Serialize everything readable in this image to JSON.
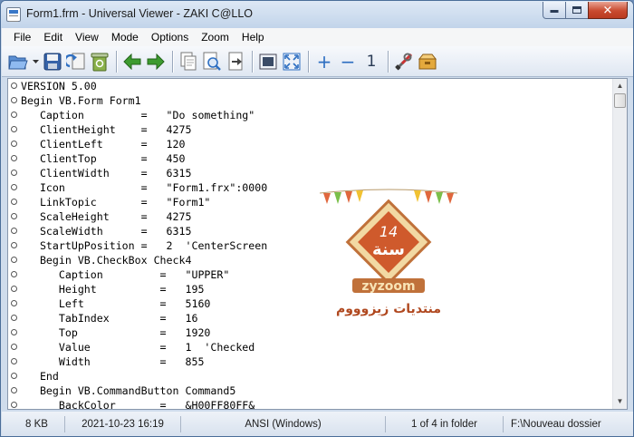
{
  "window": {
    "title": "Form1.frm - Universal Viewer - ZAKI C@LLO"
  },
  "window_controls": {
    "minimize": "",
    "maximize": "",
    "close": "✕"
  },
  "menu": {
    "items": [
      "File",
      "Edit",
      "View",
      "Mode",
      "Options",
      "Zoom",
      "Help"
    ]
  },
  "toolbar": {
    "buttons": [
      {
        "name": "open-icon"
      },
      {
        "name": "save-icon"
      },
      {
        "name": "reload-icon"
      },
      {
        "name": "recycle-bin-icon"
      },
      {
        "name": "back-arrow-icon"
      },
      {
        "name": "forward-arrow-icon"
      },
      {
        "name": "copy-icon"
      },
      {
        "name": "print-preview-icon"
      },
      {
        "name": "export-icon"
      },
      {
        "name": "fit-window-icon"
      },
      {
        "name": "fullscreen-icon"
      },
      {
        "name": "zoom-in-icon"
      },
      {
        "name": "zoom-out-icon"
      },
      {
        "name": "zoom-actual-icon"
      },
      {
        "name": "tools-icon"
      },
      {
        "name": "plugins-icon"
      }
    ],
    "zoom_in_label": "+",
    "zoom_out_label": "−",
    "zoom_actual_label": "1",
    "colors": {
      "green_arrow": "#3d9b2f",
      "blue": "#2e6fc2"
    }
  },
  "code": {
    "lines": [
      "VERSION 5.00",
      "Begin VB.Form Form1",
      "   Caption         =   \"Do something\"",
      "   ClientHeight    =   4275",
      "   ClientLeft      =   120",
      "   ClientTop       =   450",
      "   ClientWidth     =   6315",
      "   Icon            =   \"Form1.frx\":0000",
      "   LinkTopic       =   \"Form1\"",
      "   ScaleHeight     =   4275",
      "   ScaleWidth      =   6315",
      "   StartUpPosition =   2  'CenterScreen",
      "   Begin VB.CheckBox Check4",
      "      Caption         =   \"UPPER\"",
      "      Height          =   195",
      "      Left            =   5160",
      "      TabIndex        =   16",
      "      Top             =   1920",
      "      Value           =   1  'Checked",
      "      Width           =   855",
      "   End",
      "   Begin VB.CommandButton Command5",
      "      BackColor       =   &H00FF80FF&"
    ]
  },
  "watermark": {
    "number": "14",
    "arabic_year": "سنة",
    "brand": "zyzoom",
    "arabic_text": "منتديات زيزوووم"
  },
  "status": {
    "size": "8 KB",
    "datetime": "2021-10-23 16:19",
    "encoding": "ANSI (Windows)",
    "position": "1 of 4 in folder",
    "path": "F:\\Nouveau dossier"
  }
}
